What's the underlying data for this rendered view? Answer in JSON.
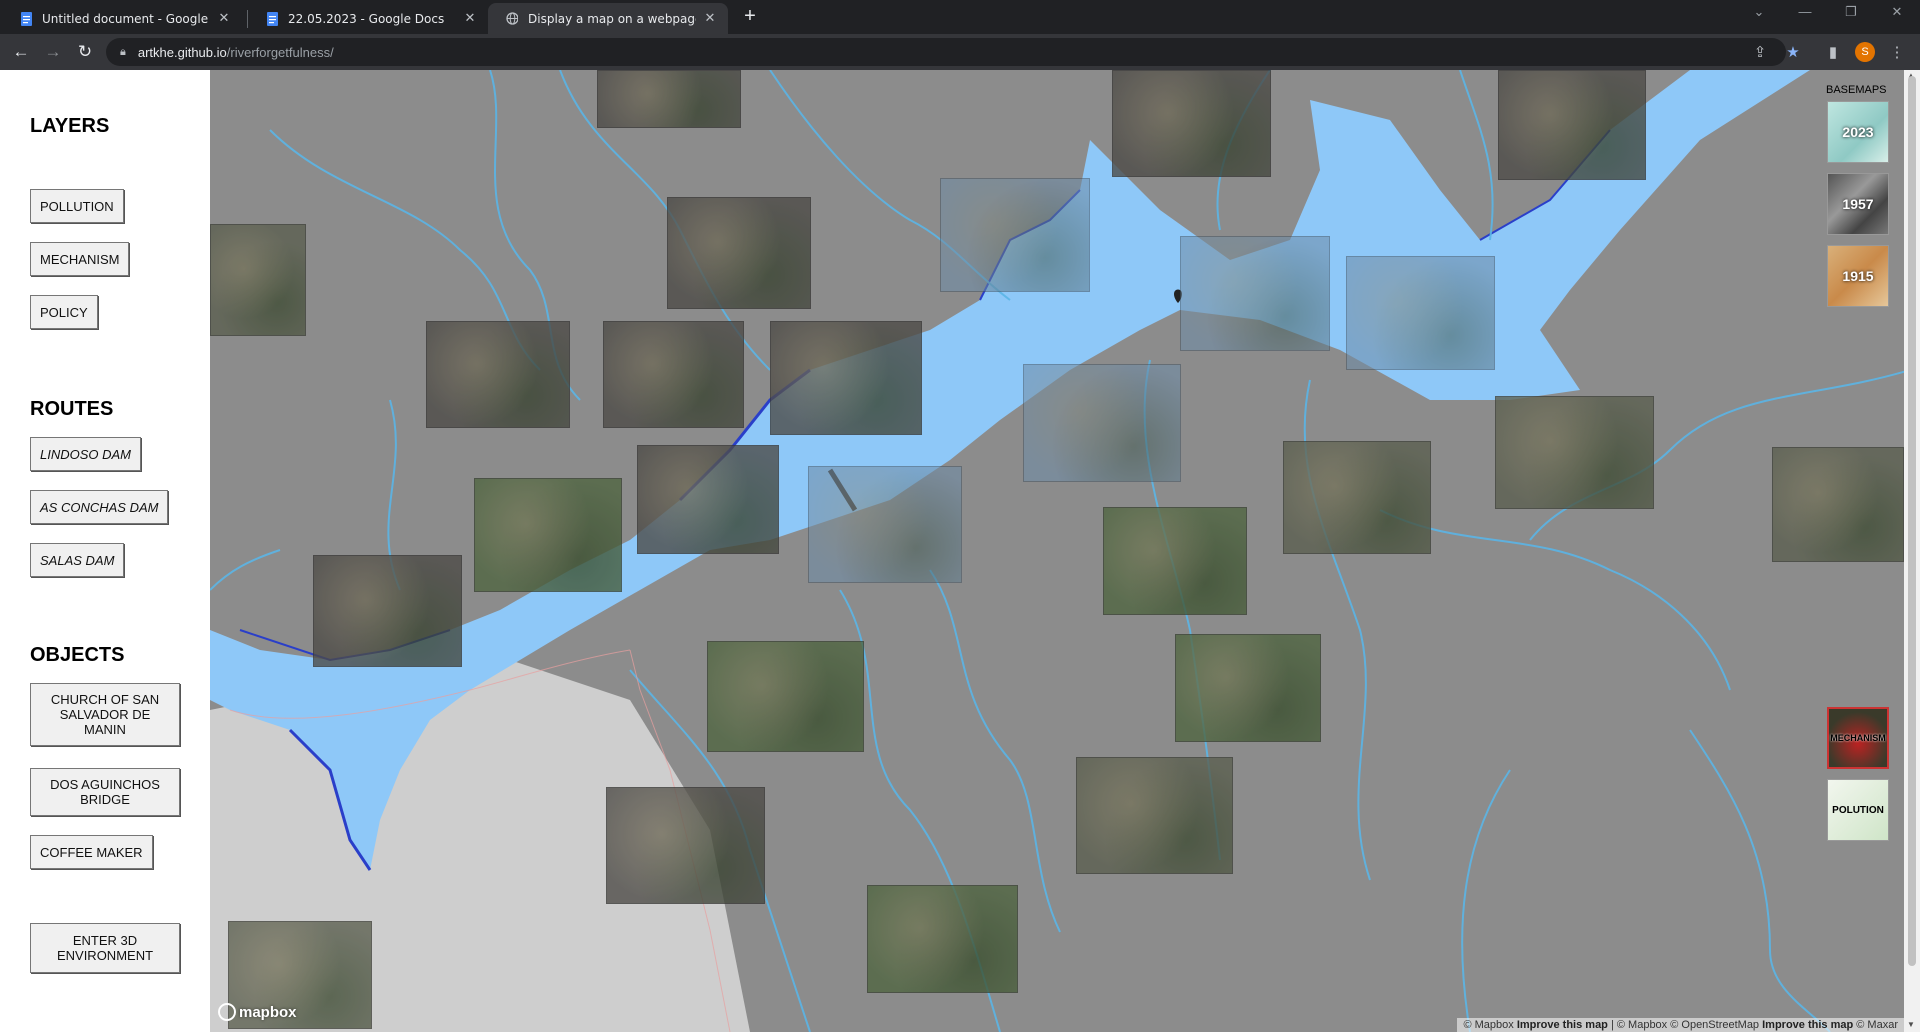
{
  "browser": {
    "tabs": [
      {
        "title": "Untitled document - Google Docs",
        "icon": "docs-icon"
      },
      {
        "title": "22.05.2023 - Google Docs",
        "icon": "docs-icon"
      },
      {
        "title": "Display a map on a webpage",
        "icon": "globe-icon"
      }
    ],
    "close_glyph": "✕",
    "new_tab_glyph": "+",
    "url_host": "artkhe.github.io",
    "url_path": "/riverforgetfulness/",
    "profile_initial": "S"
  },
  "sidebar": {
    "layers": {
      "title": "LAYERS",
      "buttons": [
        "POLLUTION",
        "MECHANISM",
        "POLICY"
      ]
    },
    "routes": {
      "title": "ROUTES",
      "buttons": [
        "LINDOSO DAM",
        "AS CONCHAS DAM",
        "SALAS DAM"
      ]
    },
    "objects": {
      "title": "OBJECTS",
      "buttons": [
        "CHURCH OF SAN SALVADOR DE MANIN",
        "DOS AGUINCHOS BRIDGE",
        "COFFEE MAKER"
      ]
    },
    "enter_3d": "ENTER 3D ENVIRONMENT"
  },
  "map": {
    "basemaps_title": "BASEMAPS",
    "basemaps": [
      "2023",
      "1957",
      "1915"
    ],
    "layer_toggles": [
      "MECHANISM",
      "POLUTION"
    ],
    "logo": "mapbox",
    "attribution": {
      "prefix": "© Mapbox",
      "improve": "Improve this map",
      "middle": "| © Mapbox © OpenStreetMap",
      "improve2": "Improve this map",
      "suffix": "© Maxar"
    },
    "colors": {
      "water": "#8ec8f8",
      "land": "#8c8c8c",
      "river_line": "#5bb5e6",
      "shore": "#2a3fc9"
    }
  }
}
